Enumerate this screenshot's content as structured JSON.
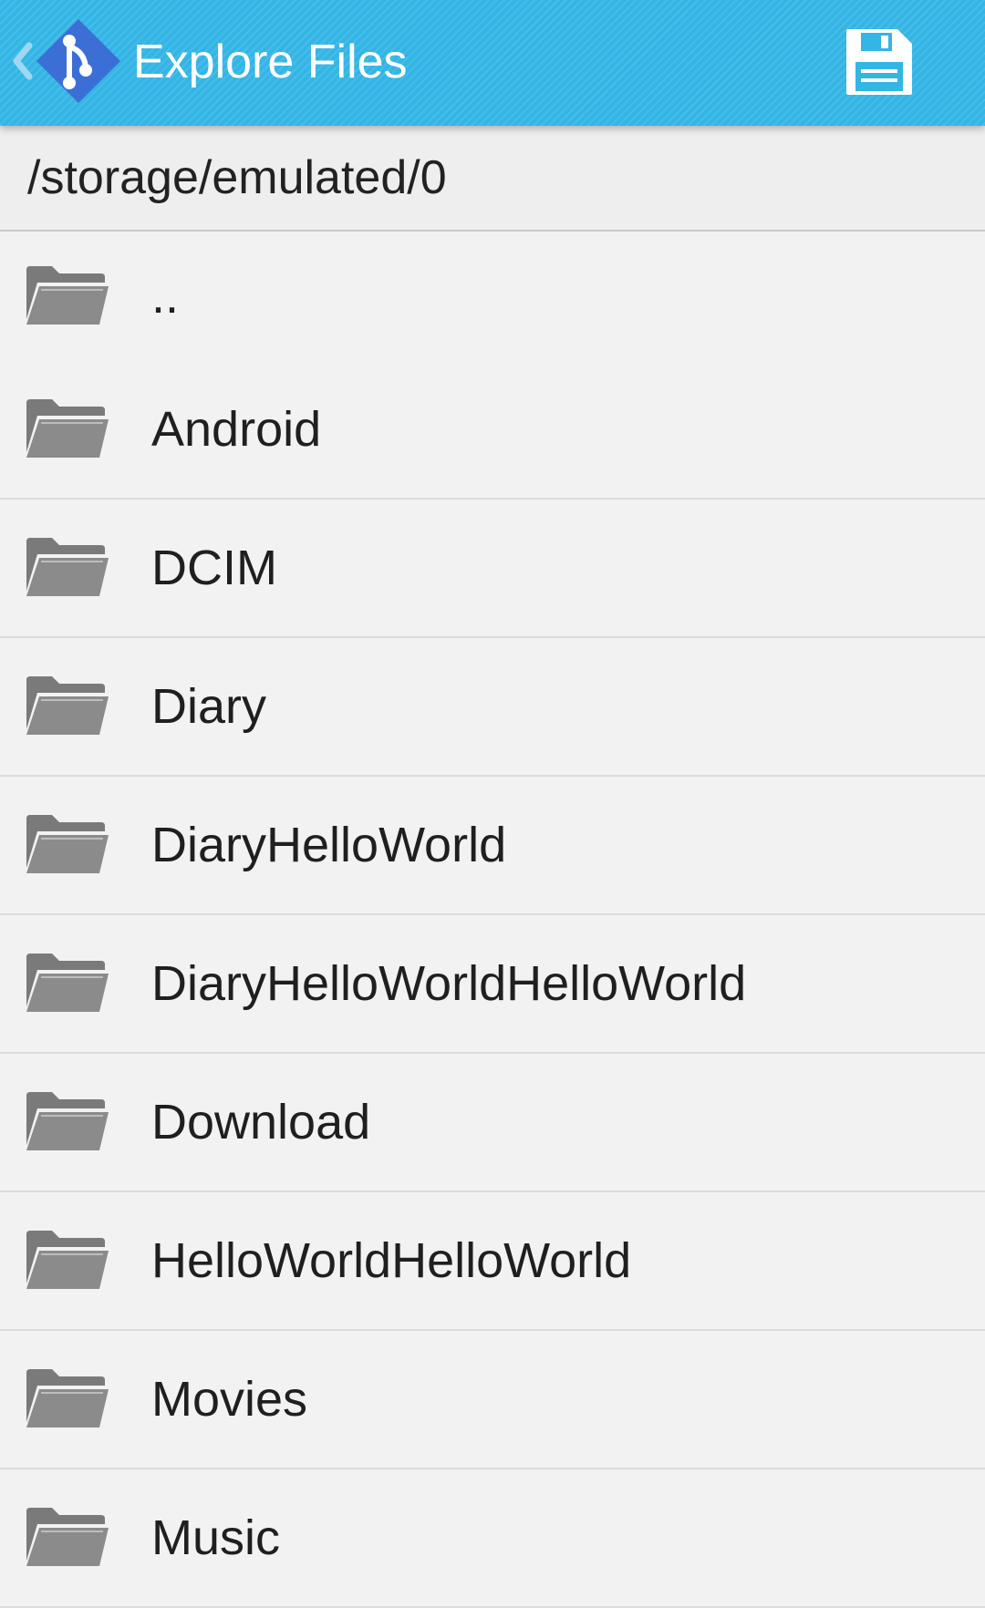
{
  "appbar": {
    "title": "Explore Files",
    "logo": "git-branch-diamond-logo",
    "back_icon": "chevron-left-icon",
    "save_icon": "floppy-disk-icon",
    "color": "#33b5e5",
    "logo_color": "#3b6fd6"
  },
  "path": "/storage/emulated/0",
  "items": [
    {
      "name": "..",
      "icon": "folder-icon"
    },
    {
      "name": "Android",
      "icon": "folder-icon"
    },
    {
      "name": "DCIM",
      "icon": "folder-icon"
    },
    {
      "name": "Diary",
      "icon": "folder-icon"
    },
    {
      "name": "DiaryHelloWorld",
      "icon": "folder-icon"
    },
    {
      "name": "DiaryHelloWorldHelloWorld",
      "icon": "folder-icon"
    },
    {
      "name": "Download",
      "icon": "folder-icon"
    },
    {
      "name": "HelloWorldHelloWorld",
      "icon": "folder-icon"
    },
    {
      "name": "Movies",
      "icon": "folder-icon"
    },
    {
      "name": "Music",
      "icon": "folder-icon"
    }
  ]
}
